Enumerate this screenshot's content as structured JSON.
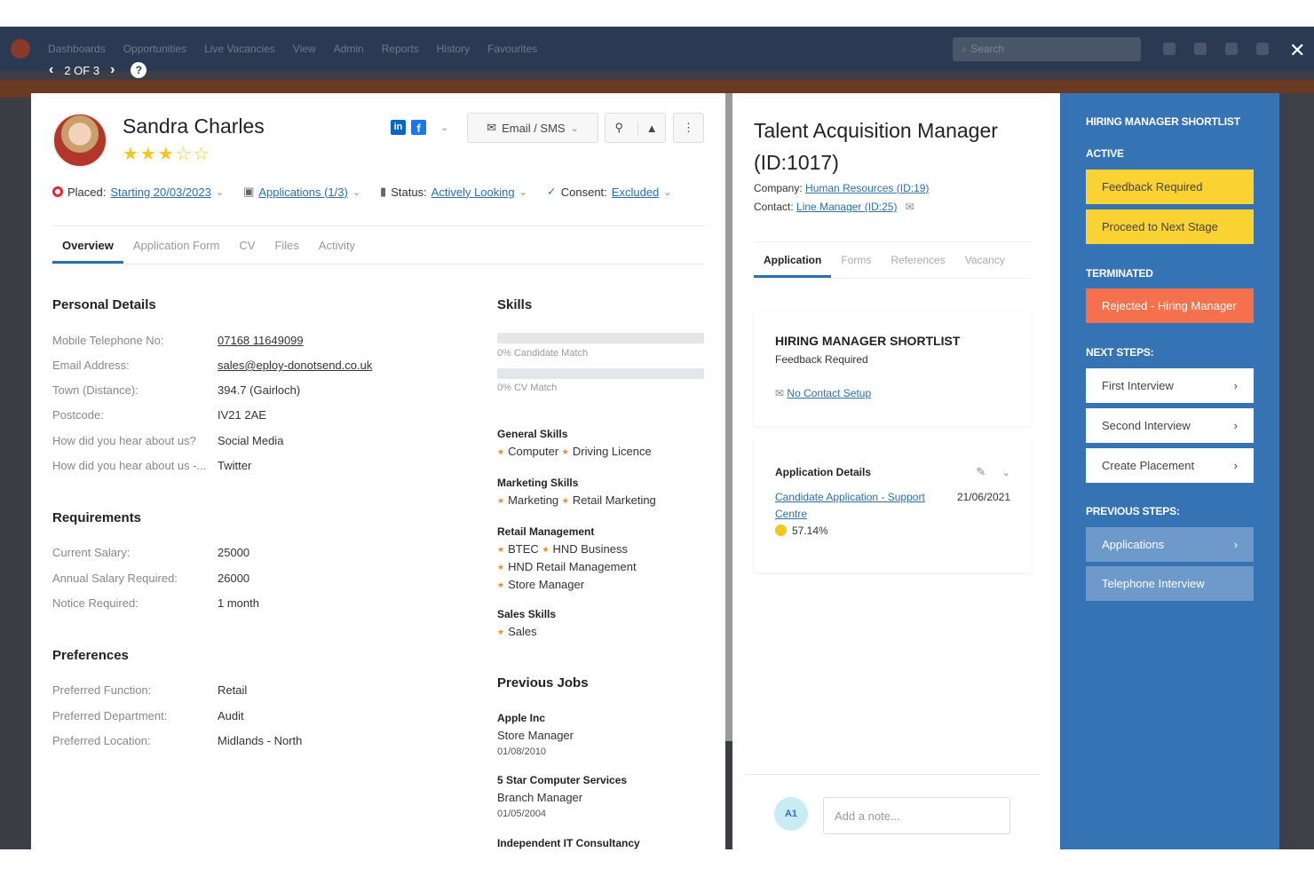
{
  "background": {
    "nav_items": [
      "Dashboards",
      "Opportunities",
      "Live Vacancies",
      "View",
      "Admin",
      "Reports",
      "History",
      "Favourites"
    ],
    "search_placeholder": "Search"
  },
  "navigator": {
    "position": "2 OF 3",
    "help": "?"
  },
  "candidate": {
    "name": "Sandra Charles",
    "rating": 3,
    "rating_max": 5,
    "stars_display": "★★★☆☆",
    "email_sms_label": "Email / SMS",
    "placed_label": "Placed:",
    "placed_value": "Starting 20/03/2023",
    "applications_value": "Applications (1/3)",
    "status_label": "Status:",
    "status_value": "Actively Looking",
    "consent_label": "Consent:",
    "consent_value": "Excluded",
    "tabs": [
      "Overview",
      "Application Form",
      "CV",
      "Files",
      "Activity"
    ],
    "personal": {
      "title": "Personal Details",
      "rows": [
        {
          "k": "Mobile Telephone No:",
          "v": "07168 11649099"
        },
        {
          "k": "Email Address:",
          "v": "sales@eploy-donotsend.co.uk"
        },
        {
          "k": "Town (Distance):",
          "v": "394.7 (Gairloch)"
        },
        {
          "k": "Postcode:",
          "v": "IV21 2AE"
        },
        {
          "k": "How did you hear about us?",
          "v": "Social Media"
        },
        {
          "k": "How did you hear about us -...",
          "v": "Twitter"
        }
      ]
    },
    "requirements": {
      "title": "Requirements",
      "rows": [
        {
          "k": "Current Salary:",
          "v": "25000"
        },
        {
          "k": "Annual Salary Required:",
          "v": "26000"
        },
        {
          "k": "Notice Required:",
          "v": "1 month"
        }
      ]
    },
    "preferences": {
      "title": "Preferences",
      "rows": [
        {
          "k": "Preferred Function:",
          "v": "Retail"
        },
        {
          "k": "Preferred Department:",
          "v": "Audit"
        },
        {
          "k": "Preferred Location:",
          "v": "Midlands - North"
        }
      ]
    },
    "skills": {
      "title": "Skills",
      "candidate_match": "0% Candidate Match",
      "cv_match": "0% CV Match",
      "groups": [
        {
          "name": "General Skills",
          "lines": [
            [
              "Computer",
              "Driving Licence"
            ]
          ]
        },
        {
          "name": "Marketing Skills",
          "lines": [
            [
              "Marketing",
              "Retail Marketing"
            ]
          ]
        },
        {
          "name": "Retail Management",
          "lines": [
            [
              "BTEC",
              "HND Business"
            ],
            [
              "HND Retail Management"
            ],
            [
              "Store Manager"
            ]
          ]
        },
        {
          "name": "Sales Skills",
          "lines": [
            [
              "Sales"
            ]
          ]
        }
      ]
    },
    "jobs": {
      "title": "Previous Jobs",
      "items": [
        {
          "company": "Apple Inc",
          "role": "Store Manager",
          "date": "01/08/2010"
        },
        {
          "company": "5 Star Computer Services",
          "role": "Branch Manager",
          "date": "01/05/2004"
        },
        {
          "company": "Independent IT Consultancy",
          "role": "",
          "date": ""
        }
      ]
    }
  },
  "vacancy": {
    "title": "Talent Acquisition Manager (ID:1017)",
    "company_label": "Company:",
    "company_value": "Human Resources (ID:19)",
    "contact_label": "Contact:",
    "contact_value": "Line Manager (ID:25)",
    "tabs": [
      "Application",
      "Forms",
      "References",
      "Vacancy"
    ],
    "stage_title": "HIRING MANAGER SHORTLIST",
    "stage_status": "Feedback Required",
    "no_contact": "No Contact Setup",
    "details_title": "Application Details",
    "source": "Candidate Application - Support Centre",
    "date": "21/06/2021",
    "score": "57.14%",
    "avatar_initials": "A1",
    "note_placeholder": "Add a note..."
  },
  "workflow": {
    "title": "HIRING MANAGER SHORTLIST",
    "active_label": "ACTIVE",
    "active": [
      "Feedback Required",
      "Proceed to Next Stage"
    ],
    "terminated_label": "TERMINATED",
    "terminated": [
      "Rejected - Hiring Manager"
    ],
    "next_label": "NEXT STEPS:",
    "next": [
      "First Interview",
      "Second Interview",
      "Create Placement"
    ],
    "previous_label": "PREVIOUS STEPS:",
    "previous": [
      "Applications",
      "Telephone Interview"
    ],
    "colors": {
      "panel": "#3573b5",
      "yellow": "#fad232",
      "orange": "#f5714e"
    }
  }
}
